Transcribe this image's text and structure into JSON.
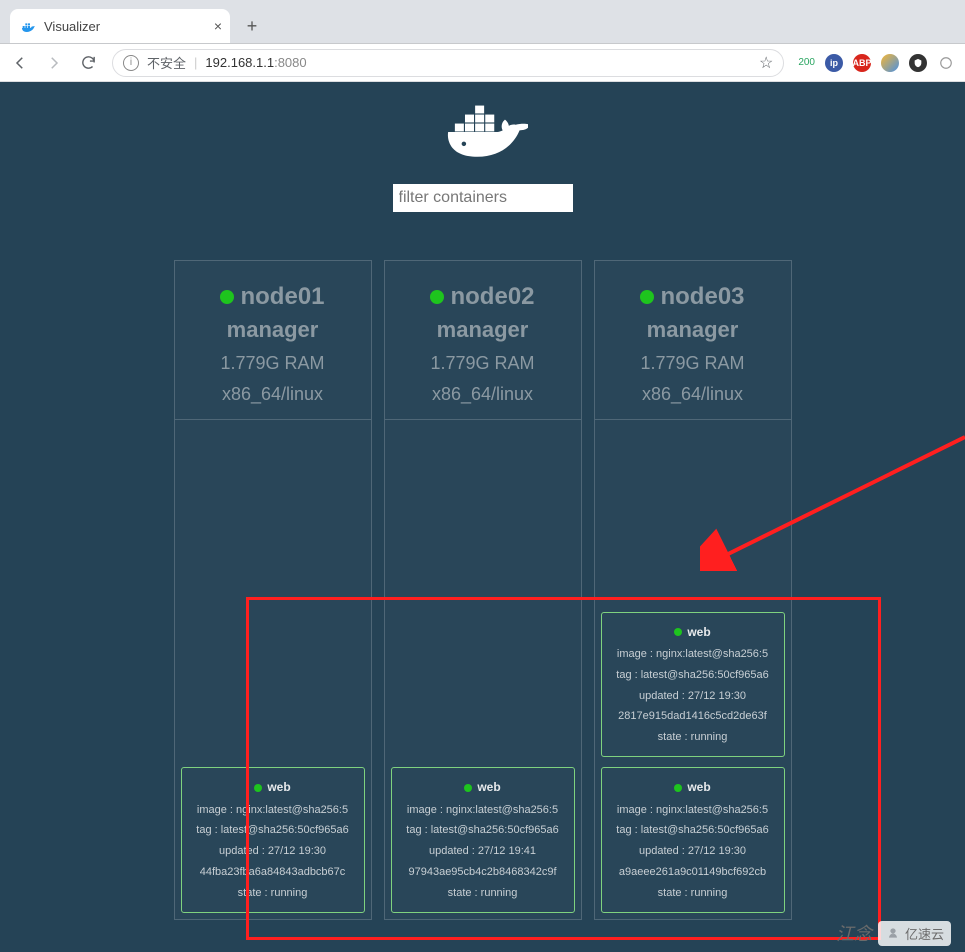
{
  "browser": {
    "tab_title": "Visualizer",
    "insecure_label": "不安全",
    "url_host": "192.168.1.1",
    "url_port": ":8080",
    "zoom_label": "200"
  },
  "filter": {
    "placeholder": "filter containers"
  },
  "nodes": [
    {
      "name": "node01",
      "role": "manager",
      "ram": "1.779G RAM",
      "arch": "x86_64/linux",
      "tasks": [
        {
          "name": "web",
          "image": "image : nginx:latest@sha256:5",
          "tag": "tag : latest@sha256:50cf965a6",
          "updated": "updated : 27/12 19:30",
          "id": "44fba23fba6a84843adbcb67c",
          "state": "state : running"
        }
      ]
    },
    {
      "name": "node02",
      "role": "manager",
      "ram": "1.779G RAM",
      "arch": "x86_64/linux",
      "tasks": [
        {
          "name": "web",
          "image": "image : nginx:latest@sha256:5",
          "tag": "tag : latest@sha256:50cf965a6",
          "updated": "updated : 27/12 19:41",
          "id": "97943ae95cb4c2b8468342c9f",
          "state": "state : running"
        }
      ]
    },
    {
      "name": "node03",
      "role": "manager",
      "ram": "1.779G RAM",
      "arch": "x86_64/linux",
      "tasks": [
        {
          "name": "web",
          "image": "image : nginx:latest@sha256:5",
          "tag": "tag : latest@sha256:50cf965a6",
          "updated": "updated : 27/12 19:30",
          "id": "2817e915dad1416c5cd2de63f",
          "state": "state : running"
        },
        {
          "name": "web",
          "image": "image : nginx:latest@sha256:5",
          "tag": "tag : latest@sha256:50cf965a6",
          "updated": "updated : 27/12 19:30",
          "id": "a9aeee261a9c01149bcf692cb",
          "state": "state : running"
        }
      ]
    }
  ],
  "watermark": {
    "text1": "江念",
    "text2": "亿速云"
  }
}
